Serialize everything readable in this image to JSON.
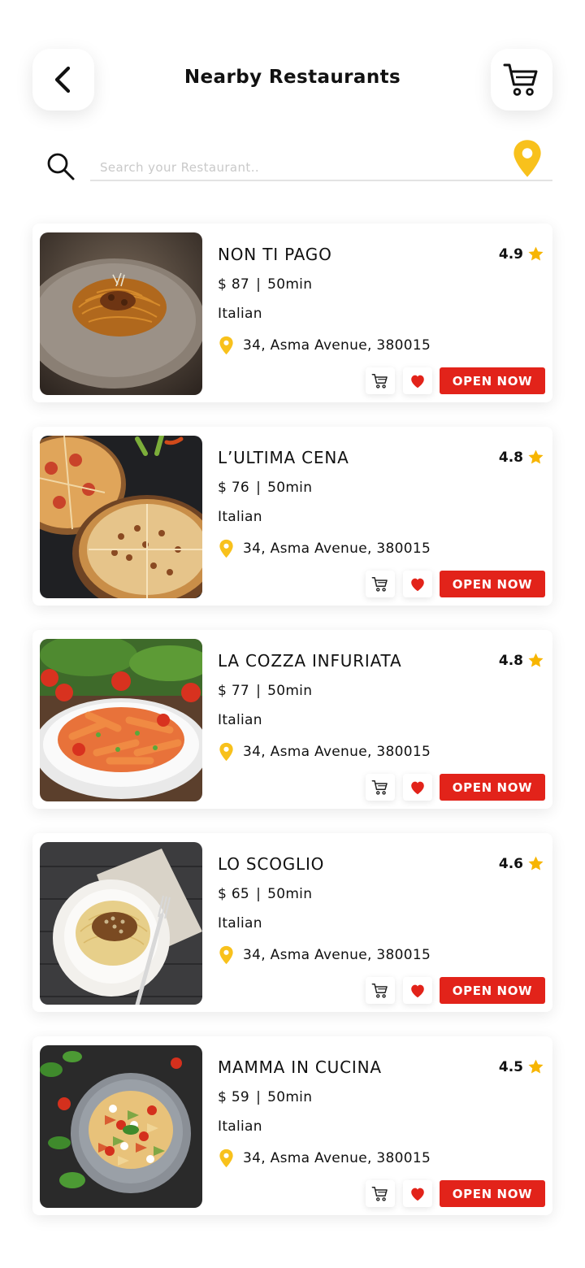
{
  "header": {
    "title": "Nearby Restaurants",
    "back_icon": "chevron-left-icon",
    "cart_icon": "cart-icon"
  },
  "search": {
    "placeholder": "Search your Restaurant..",
    "value": "",
    "search_icon": "search-icon",
    "location_icon": "location-pin-icon"
  },
  "colors": {
    "accent_red": "#e2231a",
    "star_yellow": "#f7b500",
    "pin_yellow": "#f8c11c"
  },
  "restaurants": [
    {
      "name": "NON TI PAGO",
      "rating": "4.9",
      "price": "$ 87",
      "separator": "|",
      "time": "50min",
      "cuisine": "Italian",
      "address": "34, Asma Avenue, 380015",
      "status": "OPEN NOW",
      "image": "spaghetti-bolognese-photo"
    },
    {
      "name": "L’ULTIMA CENA",
      "rating": "4.8",
      "price": "$ 76",
      "separator": "|",
      "time": "50min",
      "cuisine": "Italian",
      "address": "34, Asma Avenue, 380015",
      "status": "OPEN NOW",
      "image": "pizza-photo"
    },
    {
      "name": "LA COZZA INFURIATA",
      "rating": "4.8",
      "price": "$ 77",
      "separator": "|",
      "time": "50min",
      "cuisine": "Italian",
      "address": "34, Asma Avenue, 380015",
      "status": "OPEN NOW",
      "image": "penne-pasta-photo"
    },
    {
      "name": "LO SCOGLIO",
      "rating": "4.6",
      "price": "$ 65",
      "separator": "|",
      "time": "50min",
      "cuisine": "Italian",
      "address": "34, Asma Avenue, 380015",
      "status": "OPEN NOW",
      "image": "spaghetti-plate-photo"
    },
    {
      "name": "MAMMA IN CUCINA",
      "rating": "4.5",
      "price": "$ 59",
      "separator": "|",
      "time": "50min",
      "cuisine": "Italian",
      "address": "34, Asma Avenue, 380015",
      "status": "OPEN NOW",
      "image": "farfalle-salad-photo"
    }
  ]
}
